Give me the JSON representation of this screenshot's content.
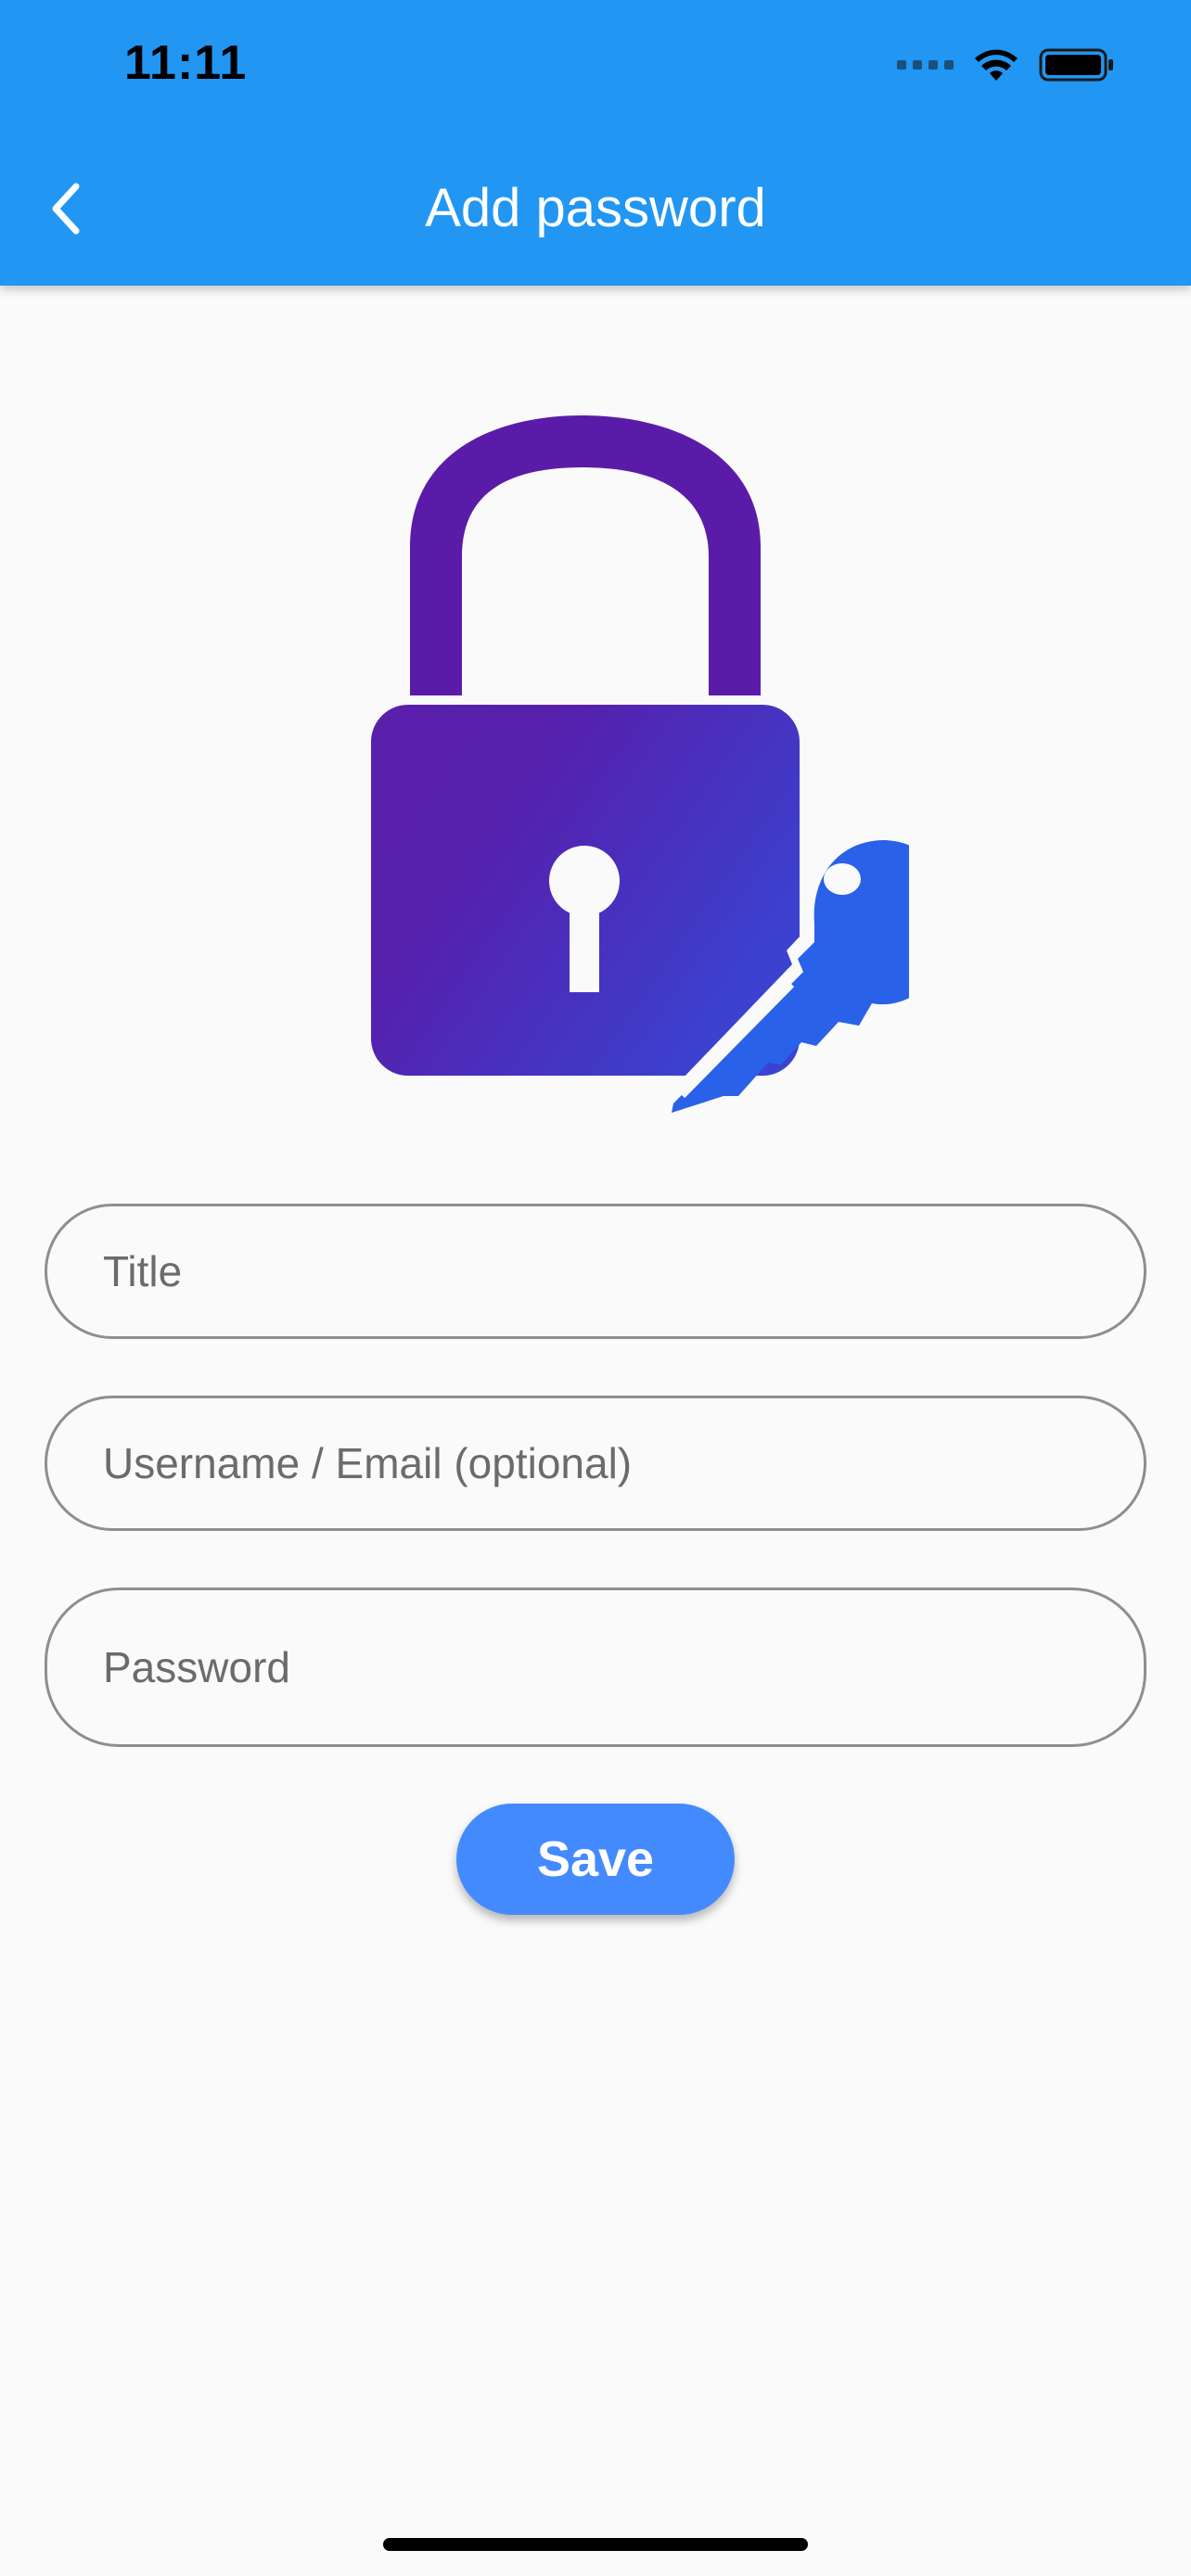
{
  "status_bar": {
    "time": "11:11"
  },
  "nav": {
    "title": "Add password",
    "back_icon": "chevron-left-icon"
  },
  "illustration": {
    "icon": "padlock-key-icon"
  },
  "form": {
    "title_placeholder": "Title",
    "title_value": "",
    "username_placeholder": "Username / Email (optional)",
    "username_value": "",
    "password_placeholder": "Password",
    "password_value": "",
    "save_label": "Save"
  },
  "colors": {
    "app_bar": "#2196f3",
    "button": "#448aff",
    "lock_dark": "#5b1fab",
    "lock_light": "#3b42d0",
    "key": "#2962e8"
  }
}
